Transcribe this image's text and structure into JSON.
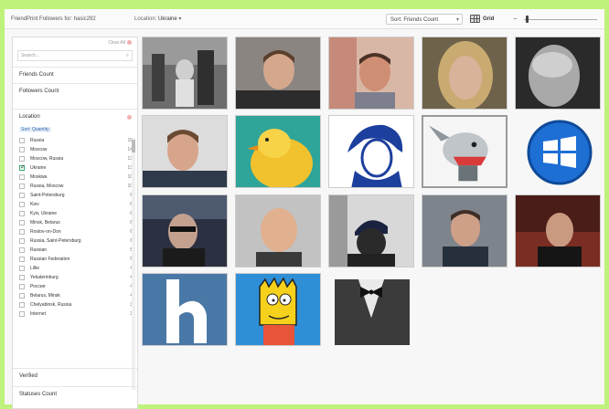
{
  "header": {
    "title": "FriendPrint Followers for: hasic292",
    "location_label": "Location:",
    "location_value": "Ukraine",
    "sort_label": "Sort: Friends Count",
    "view_label": "Grid"
  },
  "sidebar": {
    "clear_all": "Clear All",
    "search_placeholder": "Search...",
    "sections": {
      "friends": "Friends Count",
      "followers": "Followers Count",
      "location": "Location",
      "verified": "Verified",
      "statuses": "Statuses Count"
    },
    "sort_quantity": "Sort: Quantity",
    "locations": [
      {
        "label": "Russia",
        "count": "18",
        "checked": false
      },
      {
        "label": "Moscow",
        "count": "14",
        "checked": false
      },
      {
        "label": "Moscow, Russia",
        "count": "13",
        "checked": false
      },
      {
        "label": "Ukraine",
        "count": "13",
        "checked": true
      },
      {
        "label": "Moskwa",
        "count": "10",
        "checked": false
      },
      {
        "label": "Russia, Moscow",
        "count": "10",
        "checked": false
      },
      {
        "label": "Saint-Petersburg",
        "count": "6",
        "checked": false
      },
      {
        "label": "Kiev",
        "count": "6",
        "checked": false
      },
      {
        "label": "Kyiv, Ukraine",
        "count": "6",
        "checked": false
      },
      {
        "label": "Minsk, Belarus",
        "count": "6",
        "checked": false
      },
      {
        "label": "Rostov-on-Don",
        "count": "6",
        "checked": false
      },
      {
        "label": "Russia, Saint-Petersburg",
        "count": "6",
        "checked": false
      },
      {
        "label": "Russian",
        "count": "5",
        "checked": false
      },
      {
        "label": "Russian Federation",
        "count": "5",
        "checked": false
      },
      {
        "label": "Lillie",
        "count": "4",
        "checked": false
      },
      {
        "label": "Yekaterinburg",
        "count": "4",
        "checked": false
      },
      {
        "label": "Россия",
        "count": "4",
        "checked": false
      },
      {
        "label": "Belarus, Minsk",
        "count": "4",
        "checked": false
      },
      {
        "label": "Chelyabinsk, Russia",
        "count": "3",
        "checked": false
      },
      {
        "label": "Internet",
        "count": "3",
        "checked": false
      }
    ]
  },
  "grid": {
    "avatars": [
      {
        "name": "photo-gym-bw"
      },
      {
        "name": "photo-man-1"
      },
      {
        "name": "photo-man-2"
      },
      {
        "name": "photo-blonde-face"
      },
      {
        "name": "photo-man-bw-closeup"
      },
      {
        "name": "photo-man-3"
      },
      {
        "name": "photo-yellow-chick"
      },
      {
        "name": "photo-che-guevara"
      },
      {
        "name": "photo-cartoon-dog"
      },
      {
        "name": "windows-logo-icon"
      },
      {
        "name": "photo-man-car"
      },
      {
        "name": "photo-man-4"
      },
      {
        "name": "photo-man-cap"
      },
      {
        "name": "photo-man-5"
      },
      {
        "name": "photo-man-dark"
      },
      {
        "name": "h-logo-icon"
      },
      {
        "name": "bart-simpson-icon"
      },
      {
        "name": "tuxedo-bowtie-icon"
      }
    ]
  },
  "colors": {
    "accent_border": "#bff27a",
    "link_blue": "#3366aa"
  }
}
